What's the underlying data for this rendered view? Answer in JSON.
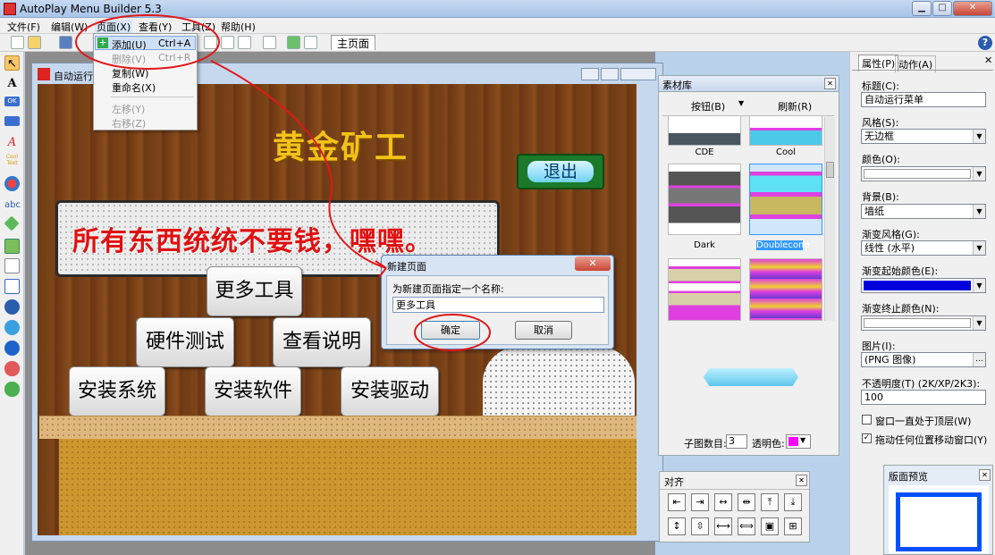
{
  "window": {
    "title": "AutoPlay Menu Builder 5.3",
    "min_glyph": "▁",
    "max_glyph": "□",
    "close_glyph": "✕"
  },
  "menubar": {
    "items": [
      "文件(F)",
      "编辑(W)",
      "页面(X)",
      "查看(Y)",
      "工具(Z)",
      "帮助(H)"
    ]
  },
  "toolbar": {
    "page_tab": "主页面",
    "help_glyph": "?"
  },
  "page_menu": {
    "items": [
      {
        "label": "添加(U)",
        "shortcut": "Ctrl+A",
        "disabled": false
      },
      {
        "label": "删除(V)",
        "shortcut": "Ctrl+R",
        "disabled": true
      },
      {
        "label": "复制(W)",
        "shortcut": "",
        "disabled": false
      },
      {
        "label": "重命名(X)",
        "shortcut": "",
        "disabled": false
      },
      {
        "label": "左移(Y)",
        "shortcut": "",
        "disabled": true
      },
      {
        "label": "右移(Z)",
        "shortcut": "",
        "disabled": true
      }
    ]
  },
  "left_tools": [
    "arrow-tool",
    "text-tool",
    "ok-button-tool",
    "button-tool",
    "fancy-text-tool",
    "cool-text-tool",
    "shape-tool",
    "abc-tool",
    "icon-tool",
    "image-tool",
    "list-tool",
    "doc-tool",
    "link-tool",
    "ie-tool",
    "media-tool",
    "chat-tool",
    "comment-tool"
  ],
  "left_tool_glyphs": {
    "arrow": "↖",
    "text": "A",
    "ok": "OK",
    "fancy": "A",
    "cool": "Cool Text",
    "abc": "abc"
  },
  "page_window": {
    "title": "自动运行菜单"
  },
  "stage": {
    "title": "黄金矿工",
    "banner": "所有东西统统不要钱，嘿嘿。",
    "exit": "退出",
    "buttons": [
      "更多工具",
      "硬件测试",
      "查看说明",
      "安装系统",
      "安装软件",
      "安装驱动"
    ]
  },
  "dialog": {
    "title": "新建页面",
    "prompt": "为新建页面指定一个名称:",
    "value": "更多工具",
    "ok": "确定",
    "cancel": "取消",
    "close_glyph": "✕"
  },
  "material_library": {
    "title": "素材库",
    "tab_buttons": "按钮(B)",
    "refresh": "刷新(R)",
    "items": [
      "CDE",
      "Cool",
      "Dark",
      "Doublecone",
      "",
      ""
    ],
    "selected": "Doublecone",
    "sub_count_label": "子图数目:",
    "sub_count": "3",
    "transparent_label": "透明色:"
  },
  "align_panel": {
    "title": "对齐"
  },
  "properties": {
    "tabs": [
      "属性(P)",
      "动作(A)"
    ],
    "fields": [
      {
        "label": "标题(C):",
        "value": "自动运行菜单",
        "type": "text"
      },
      {
        "label": "风格(S):",
        "value": "无边框",
        "type": "select"
      },
      {
        "label": "颜色(O):",
        "value": "",
        "type": "color"
      },
      {
        "label": "背景(B):",
        "value": "墙纸",
        "type": "select"
      },
      {
        "label": "渐变风格(G):",
        "value": "线性 (水平)",
        "type": "select"
      },
      {
        "label": "渐变起始颜色(E):",
        "value": "",
        "type": "color"
      },
      {
        "label": "渐变终止颜色(N):",
        "value": "",
        "type": "color"
      },
      {
        "label": "图片(I):",
        "value": "(PNG 图像)",
        "type": "browse"
      },
      {
        "label": "不透明度(T) (2K/XP/2K3):",
        "value": "100",
        "type": "spin"
      }
    ],
    "checkboxes": [
      {
        "label": "窗口一直处于顶层(W)",
        "checked": false
      },
      {
        "label": "拖动任何位置移动窗口(Y)",
        "checked": true
      }
    ],
    "preview_title": "版面预览"
  },
  "colors": {
    "gradient_start": "#0000dd",
    "transparent": "#ff00ff",
    "accent": "#3399ff",
    "annotation": "#e01818"
  }
}
